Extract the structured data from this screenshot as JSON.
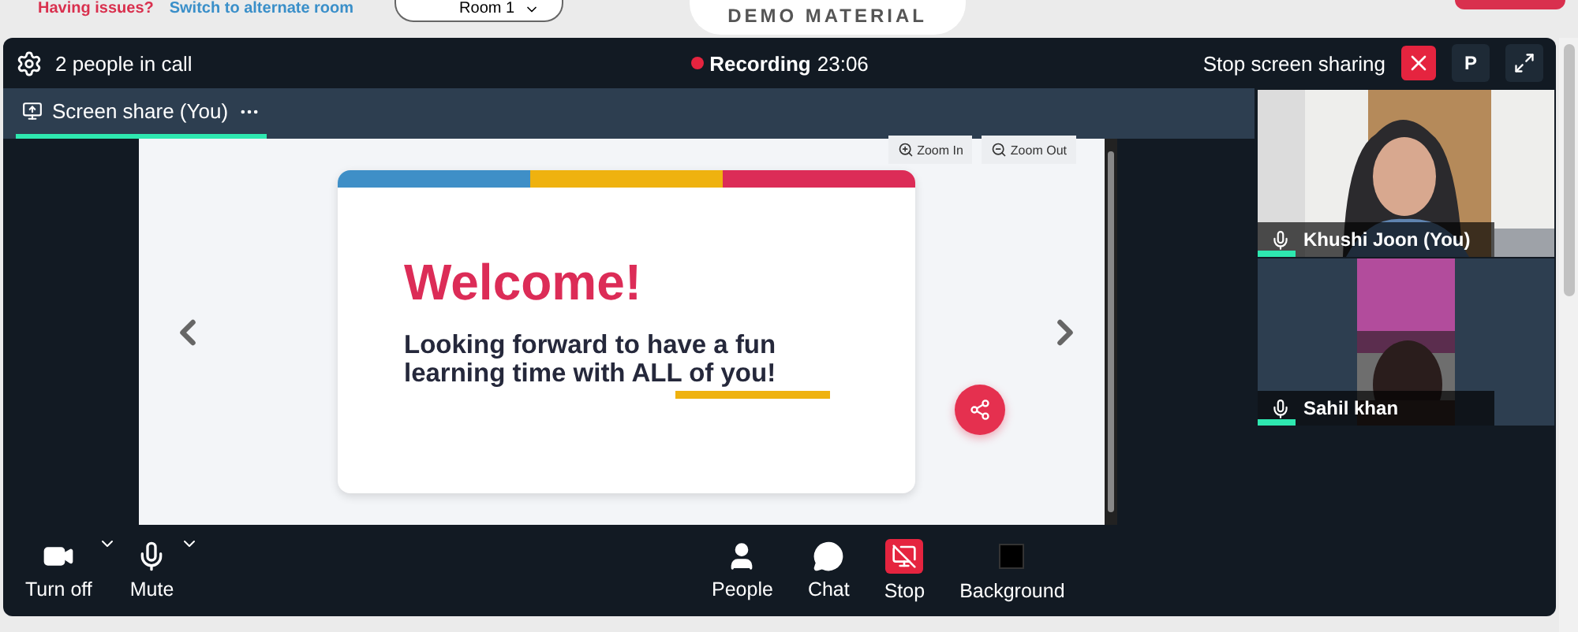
{
  "top_strip": {
    "notice": "Having issues?",
    "link": "Switch to alternate room",
    "room_select": "Room 1",
    "material_tab": "DEMO MATERIAL"
  },
  "header": {
    "people_count": "2 people in call",
    "recording": {
      "on": true,
      "label": "Recording",
      "time": "23:06"
    },
    "stop_sharing": "Stop screen sharing",
    "avatar": "P"
  },
  "tabs": [
    {
      "label": "Screen share (You)",
      "selected": true
    }
  ],
  "slide": {
    "zoom_in": "Zoom In",
    "zoom_out": "Zoom Out",
    "title": "Welcome!",
    "body": "Looking forward to have a fun learning time with ALL of you!"
  },
  "participants": [
    {
      "name": "Khushi Joon (You)",
      "kind": "full"
    },
    {
      "name": "Sahil khan",
      "kind": "narrow"
    }
  ],
  "toolbar": {
    "left": [
      {
        "kind": "camera",
        "label": "Turn off"
      },
      {
        "kind": "mic",
        "label": "Mute"
      }
    ],
    "center": [
      {
        "kind": "people",
        "label": "People"
      },
      {
        "kind": "chat",
        "label": "Chat"
      },
      {
        "kind": "stop",
        "label": "Stop"
      },
      {
        "kind": "background",
        "label": "Background"
      }
    ]
  }
}
